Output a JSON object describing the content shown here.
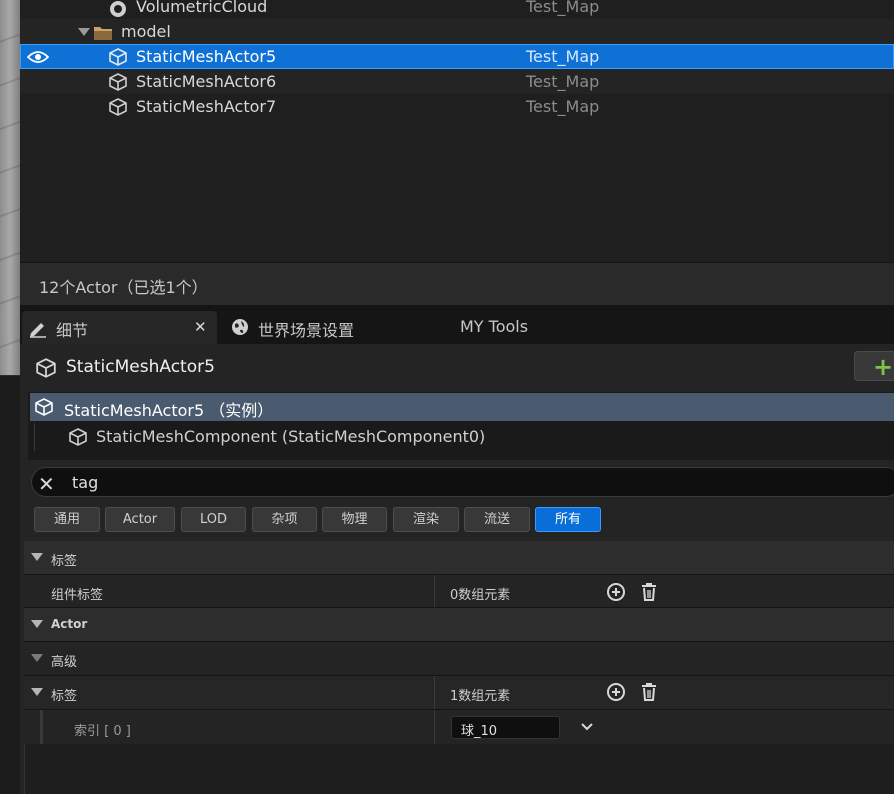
{
  "outliner": {
    "rows": [
      {
        "label": "VolumetricCloud",
        "map": "Test_Map"
      },
      {
        "label": "model",
        "map": ""
      },
      {
        "label": "StaticMeshActor5",
        "map": "Test_Map"
      },
      {
        "label": "StaticMeshActor6",
        "map": "Test_Map"
      },
      {
        "label": "StaticMeshActor7",
        "map": "Test_Map"
      }
    ],
    "status": "12个Actor（已选1个）"
  },
  "tabs": [
    {
      "label": "细节",
      "icon": "pencil-icon"
    },
    {
      "label": "世界场景设置",
      "icon": "globe-icon"
    },
    {
      "label": "MY Tools"
    }
  ],
  "details": {
    "actor_name": "StaticMeshActor5",
    "components": [
      {
        "label": "StaticMeshActor5 （实例）"
      },
      {
        "label": "StaticMeshComponent (StaticMeshComponent0)"
      }
    ],
    "search": {
      "value": "tag"
    },
    "filters": [
      "通用",
      "Actor",
      "LOD",
      "杂项",
      "物理",
      "渲染",
      "流送",
      "所有"
    ],
    "active_filter": "所有",
    "properties": {
      "cat1": "标签",
      "comp_tags_label": "组件标签",
      "comp_tags_value": "0数组元素",
      "cat_actor": "Actor",
      "advanced": "高级",
      "tags_label": "标签",
      "tags_value": "1数组元素",
      "index_label": "索引 [ 0 ]",
      "index_value": "球_10"
    }
  },
  "colors": {
    "selection": "#0f71d6",
    "active_filter": "#0a6ed8",
    "add_plus": "#7ec24a"
  }
}
